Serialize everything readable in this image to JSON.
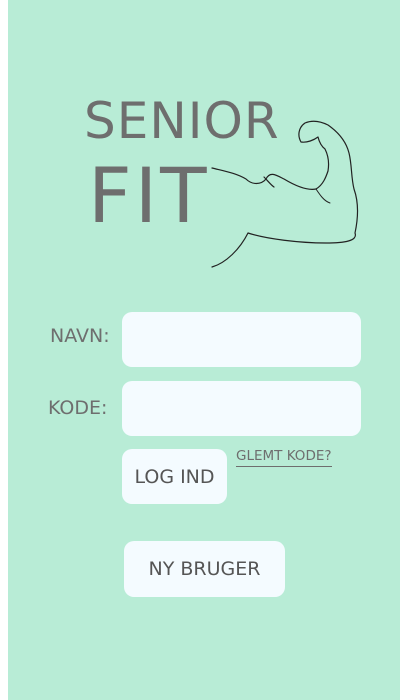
{
  "logo": {
    "line1": "SENIOR",
    "line2": "FIT",
    "icon": "flexed-arm-icon"
  },
  "form": {
    "name_label": "NAVN:",
    "name_value": "",
    "password_label": "KODE:",
    "password_value": "",
    "login_button": "LOG IND",
    "forgot_link": "GLEMT KODE?",
    "new_user_button": "NY BRUGER"
  },
  "colors": {
    "background": "#b8ecd6",
    "field": "#f4fbff",
    "text": "#6e6e6e"
  }
}
